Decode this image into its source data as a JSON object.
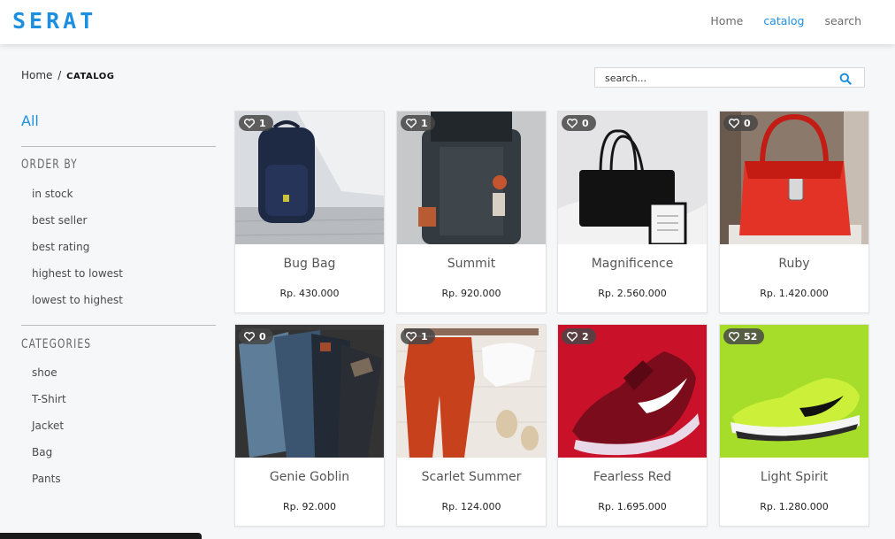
{
  "header": {
    "brand": "SERAT",
    "nav": [
      {
        "label": "Home"
      },
      {
        "label": "catalog",
        "active": true
      },
      {
        "label": "search"
      }
    ]
  },
  "breadcrumb": {
    "home": "Home",
    "separator": "/",
    "current": "CATALOG"
  },
  "search": {
    "placeholder": "search...",
    "icon": "search-icon"
  },
  "sidebar": {
    "all": "All",
    "order_by_title": "ORDER BY",
    "order_by": [
      "in stock",
      "best seller",
      "best rating",
      "highest to lowest",
      "lowest to highest"
    ],
    "categories_title": "CATEGORIES",
    "categories": [
      "shoe",
      "T-Shirt",
      "Jacket",
      "Bag",
      "Pants"
    ]
  },
  "products": [
    {
      "name": "Bug Bag",
      "price": "Rp. 430.000",
      "likes": "1",
      "image": "navy-backpack"
    },
    {
      "name": "Summit",
      "price": "Rp. 920.000",
      "likes": "1",
      "image": "dark-rolltop-backpack"
    },
    {
      "name": "Magnificence",
      "price": "Rp. 2.560.000",
      "likes": "0",
      "image": "black-handbag"
    },
    {
      "name": "Ruby",
      "price": "Rp. 1.420.000",
      "likes": "0",
      "image": "red-handbag"
    },
    {
      "name": "Genie Goblin",
      "price": "Rp. 92.000",
      "likes": "0",
      "image": "folded-jeans"
    },
    {
      "name": "Scarlet Summer",
      "price": "Rp. 124.000",
      "likes": "1",
      "image": "orange-pants-outfit"
    },
    {
      "name": "Fearless Red",
      "price": "Rp. 1.695.000",
      "likes": "2",
      "image": "red-sneaker"
    },
    {
      "name": "Light Spirit",
      "price": "Rp. 1.280.000",
      "likes": "52",
      "image": "lime-sneaker"
    }
  ],
  "colors": {
    "accent": "#1d8fe0",
    "badge": "#464646",
    "background": "#f6f7f9"
  }
}
